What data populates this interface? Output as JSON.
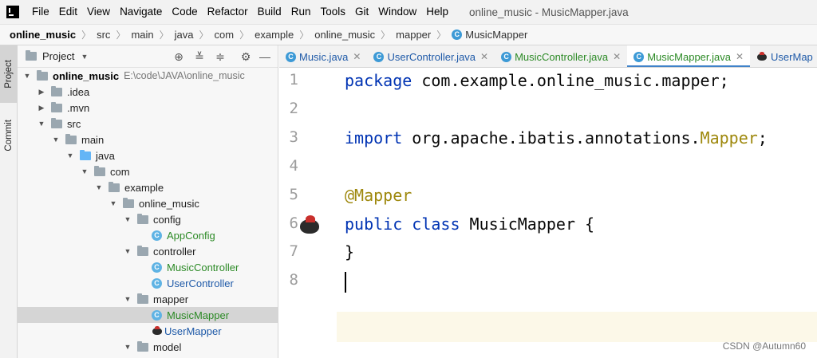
{
  "menubar": {
    "items": [
      "File",
      "Edit",
      "View",
      "Navigate",
      "Code",
      "Refactor",
      "Build",
      "Run",
      "Tools",
      "Git",
      "Window",
      "Help"
    ],
    "window_title": "online_music - MusicMapper.java"
  },
  "breadcrumb": {
    "items": [
      "online_music",
      "src",
      "main",
      "java",
      "com",
      "example",
      "online_music",
      "mapper"
    ],
    "class_icon": "C",
    "current": "MusicMapper"
  },
  "tool_strip": {
    "project": "Project",
    "commit": "Commit"
  },
  "project_panel": {
    "title": "Project",
    "root_label": "online_music",
    "root_path": "E:\\code\\JAVA\\online_music",
    "tree": [
      {
        "label": ".idea",
        "icon": "folder-icon"
      },
      {
        "label": ".mvn",
        "icon": "folder-icon"
      },
      {
        "label": "src",
        "icon": "folder-icon"
      },
      {
        "label": "main",
        "icon": "folder-icon"
      },
      {
        "label": "java",
        "icon": "folder-icon"
      },
      {
        "label": "com",
        "icon": "folder-icon"
      },
      {
        "label": "example",
        "icon": "folder-icon"
      },
      {
        "label": "online_music",
        "icon": "folder-icon"
      },
      {
        "label": "config",
        "icon": "folder-icon"
      },
      {
        "label": "AppConfig",
        "icon": "class-icon"
      },
      {
        "label": "controller",
        "icon": "folder-icon"
      },
      {
        "label": "MusicController",
        "icon": "class-icon"
      },
      {
        "label": "UserController",
        "icon": "class-icon"
      },
      {
        "label": "mapper",
        "icon": "folder-icon"
      },
      {
        "label": "MusicMapper",
        "icon": "class-icon"
      },
      {
        "label": "UserMapper",
        "icon": "mybatis-bird-icon"
      },
      {
        "label": "model",
        "icon": "folder-icon"
      }
    ]
  },
  "tabs": [
    {
      "label": "Music.java",
      "icon": "C"
    },
    {
      "label": "UserController.java",
      "icon": "C"
    },
    {
      "label": "MusicController.java",
      "icon": "C"
    },
    {
      "label": "MusicMapper.java",
      "icon": "C"
    },
    {
      "label": "UserMap",
      "icon": "mybatis-bird-icon"
    }
  ],
  "editor": {
    "line_numbers": [
      "1",
      "2",
      "3",
      "4",
      "5",
      "6",
      "7",
      "8"
    ],
    "code": {
      "l1_kw": "package",
      "l1_rest": " com.example.online_music.mapper;",
      "l3_kw": "import",
      "l3_rest": " org.apache.ibatis.annotations.",
      "l3_ann": "Mapper",
      "l3_end": ";",
      "l5_ann": "@Mapper",
      "l6_kw1": "public",
      "l6_kw2": "class",
      "l6_rest": " MusicMapper {",
      "l7": "}"
    }
  },
  "watermark": "CSDN @Autumn60",
  "colors": {
    "keyword": "#0033b3",
    "annotation": "#9e880d",
    "accent": "#4083c9",
    "class_icon": "#3d9ad6"
  }
}
